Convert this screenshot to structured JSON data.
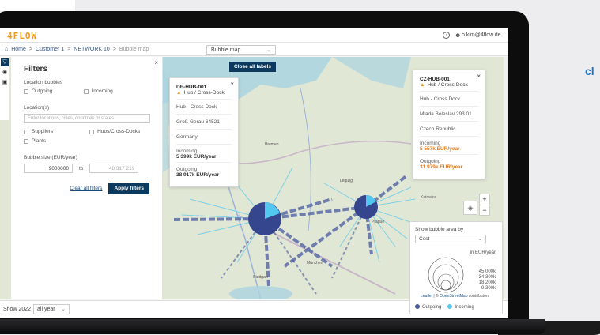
{
  "side_text": "cl",
  "app": {
    "logo": "4FLOW",
    "user_email": "o.kim@4flow.de",
    "help_icon": "?",
    "user_icon": "person-icon"
  },
  "breadcrumb": {
    "home": "Home",
    "customer": "Customer 1",
    "network": "NETWORK 10",
    "current": "Bubble map",
    "separator": ">"
  },
  "view_select": {
    "value": "Bubble map",
    "chevron": "⌄"
  },
  "filters": {
    "title": "Filters",
    "close": "×",
    "location_bubbles_label": "Location bubbles",
    "outgoing": "Outgoing",
    "incoming": "Incoming",
    "locations_label": "Location(s)",
    "locations_placeholder": "Enter locations, cities, countries or states",
    "suppliers": "Suppliers",
    "hubs": "Hubs/Cross-Docks",
    "plants": "Plants",
    "bubble_size_label": "Bubble size (EUR/year)",
    "min_value": "9000000",
    "to_label": "to",
    "max_placeholder": "48 317 219",
    "clear_all": "Clear all filters",
    "apply": "Apply filters"
  },
  "map_buttons": {
    "close_all_labels": "Close all labels"
  },
  "popup_de": {
    "close": "×",
    "id": "DE-HUB-001",
    "type": "Hub / Cross-Dock",
    "subtype": "Hub - Cross Dock",
    "address": "Groß-Gerau 64521",
    "country": "Germany",
    "incoming_label": "Incoming",
    "incoming_value": "5 399k EUR/year",
    "outgoing_label": "Outgoing",
    "outgoing_value": "38 917k EUR/year"
  },
  "popup_cz": {
    "close": "×",
    "id": "CZ-HUB-001",
    "type": "Hub / Cross-Dock",
    "subtype": "Hub - Cross Dock",
    "address": "Mlada Boleslav 293 01",
    "country": "Czech Republic",
    "incoming_label": "Incoming",
    "incoming_value": "5 557k EUR/year",
    "outgoing_label": "Outgoing",
    "outgoing_value": "31 979k EUR/year"
  },
  "zoom": {
    "in": "+",
    "out": "−"
  },
  "legend": {
    "title": "Show bubble area by",
    "select_value": "Cost",
    "unit": "in EUR/year",
    "values": [
      "45 000k",
      "34 300k",
      "18 200k",
      "9 300k"
    ],
    "outgoing": "Outgoing",
    "incoming": "Incoming",
    "colors": {
      "outgoing": "#4b5a9a",
      "incoming": "#53c7ef"
    }
  },
  "map_labels": {
    "city_1": "Bremen",
    "city_2": "Leipzig",
    "city_3": "Katowice",
    "city_4": "München",
    "city_5": "Stuttgart",
    "city_6": "Prague"
  },
  "attribution": {
    "leaflet": "Leaflet",
    "osm": "OpenStreetMap",
    "contributors": " contributors",
    "sep": " | © "
  },
  "bottom": {
    "show_label": "Show 2022",
    "period": "all year",
    "chevron": "⌄"
  }
}
